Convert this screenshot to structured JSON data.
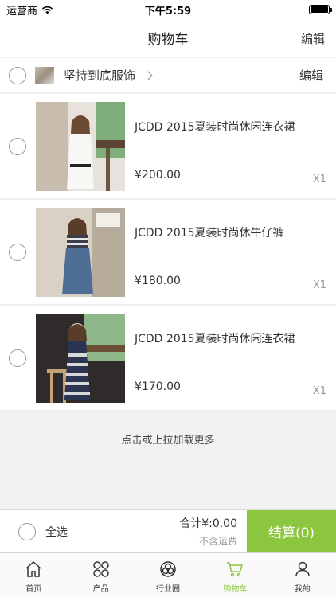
{
  "status_bar": {
    "carrier": "运营商",
    "time": "下午5:59"
  },
  "header": {
    "title": "购物车",
    "edit_label": "编辑"
  },
  "shop": {
    "name": "坚持到底服饰",
    "edit_label": "编辑"
  },
  "items": [
    {
      "name": "JCDD 2015夏装时尚休闲连衣裙",
      "price": "¥200.00",
      "qty": "X1"
    },
    {
      "name": "JCDD 2015夏装时尚休牛仔裤",
      "price": "¥180.00",
      "qty": "X1"
    },
    {
      "name": "JCDD 2015夏装时尚休闲连衣裙",
      "price": "¥170.00",
      "qty": "X1"
    }
  ],
  "load_more": "点击或上拉加载更多",
  "checkout": {
    "select_all": "全选",
    "total": "合计¥:0.00",
    "shipping_note": "不含运费",
    "button_label": "结算(0)"
  },
  "tabs": [
    {
      "label": "首页",
      "icon": "home-icon"
    },
    {
      "label": "产品",
      "icon": "products-icon"
    },
    {
      "label": "行业圈",
      "icon": "industry-circle-icon"
    },
    {
      "label": "购物车",
      "icon": "cart-icon",
      "active": true
    },
    {
      "label": "我的",
      "icon": "profile-icon"
    }
  ],
  "colors": {
    "accent": "#8cc63f",
    "background": "#f2f2f2"
  }
}
